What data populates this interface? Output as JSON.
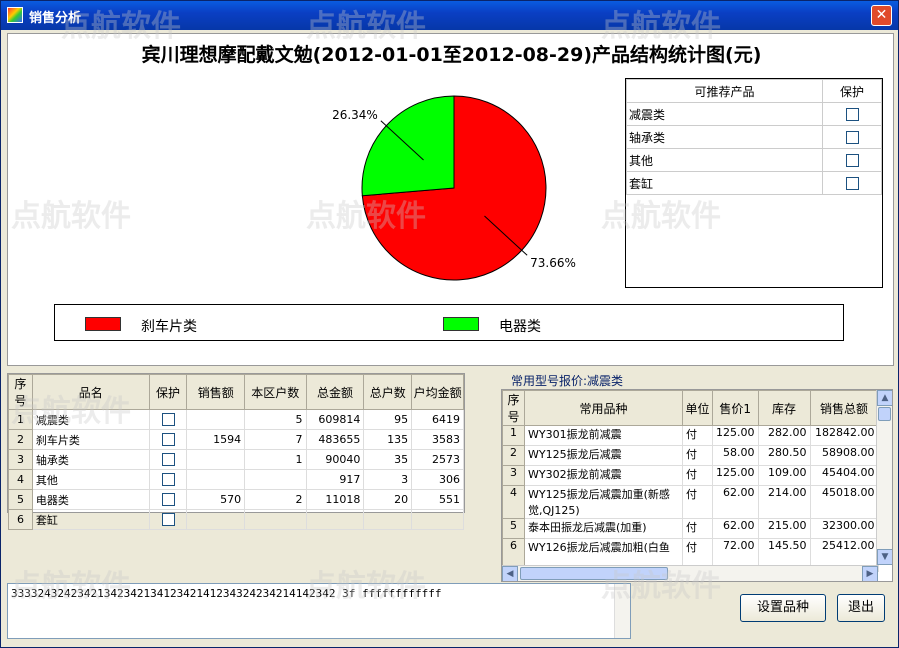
{
  "window": {
    "title": "销售分析",
    "close_label": "✕"
  },
  "chart_title": "宾川理想摩配戴文勉(2012-01-01至2012-08-29)产品结构统计图(元)",
  "chart_data": {
    "type": "pie",
    "title": "宾川理想摩配戴文勉(2012-01-01至2012-08-29)产品结构统计图(元)",
    "categories": [
      "刹车片类",
      "电器类"
    ],
    "values": [
      73.66,
      26.34
    ],
    "labels": [
      "73.66%",
      "26.34%"
    ],
    "colors": [
      "#ff0000",
      "#00ff00"
    ],
    "legend": "bottom"
  },
  "recommend": {
    "headers": [
      "可推荐产品",
      "保护"
    ],
    "rows": [
      "减震类",
      "轴承类",
      "其他",
      "套缸"
    ]
  },
  "grid1": {
    "headers": [
      "序号",
      "品名",
      "保护",
      "销售额",
      "本区户数",
      "总金额",
      "总户数",
      "户均金额"
    ],
    "rows": [
      [
        "1",
        "减震类",
        "",
        "",
        "5",
        "609814",
        "95",
        "6419"
      ],
      [
        "2",
        "刹车片类",
        "",
        "1594",
        "7",
        "483655",
        "135",
        "3583"
      ],
      [
        "3",
        "轴承类",
        "",
        "",
        "1",
        "90040",
        "35",
        "2573"
      ],
      [
        "4",
        "其他",
        "",
        "",
        "",
        "917",
        "3",
        "306"
      ],
      [
        "5",
        "电器类",
        "",
        "570",
        "2",
        "11018",
        "20",
        "551"
      ],
      [
        "6",
        "套缸",
        "",
        "",
        "",
        "",
        "",
        ""
      ]
    ]
  },
  "grid2": {
    "label": "常用型号报价:减震类",
    "headers": [
      "序号",
      "常用品种",
      "单位",
      "售价1",
      "库存",
      "销售总额"
    ],
    "rows": [
      [
        "1",
        "WY301振龙前减震",
        "付",
        "125.00",
        "282.00",
        "182842.00"
      ],
      [
        "2",
        "WY125振龙后减震",
        "付",
        "58.00",
        "280.50",
        "58908.00"
      ],
      [
        "3",
        "WY302振龙前减震",
        "付",
        "125.00",
        "109.00",
        "45404.00"
      ],
      [
        "4",
        "WY125振龙后减震加重(新感觉,QJ125)",
        "付",
        "62.00",
        "214.00",
        "45018.00"
      ],
      [
        "5",
        "泰本田振龙后减震(加重)",
        "付",
        "62.00",
        "215.00",
        "32300.00"
      ],
      [
        "6",
        "WY126振龙后减震加粗(白鱼",
        "付",
        "72.00",
        "145.50",
        "25412.00"
      ]
    ]
  },
  "textbox": {
    "value": "3333243242342134234213412342141234324234214142342 3f ffffffffffff"
  },
  "buttons": {
    "setup": "设置品种",
    "exit": "退出"
  },
  "watermark": "点航软件"
}
